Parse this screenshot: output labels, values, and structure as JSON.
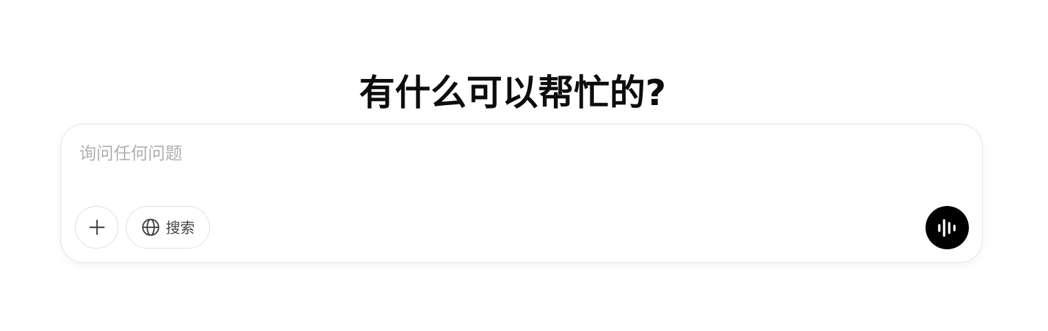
{
  "headline": "有什么可以帮忙的?",
  "composer": {
    "placeholder": "询问任何问题",
    "value": ""
  },
  "toolbar": {
    "attach_icon": "plus-icon",
    "search_icon": "globe-icon",
    "search_label": "搜索",
    "voice_icon": "voice-waveform-icon"
  },
  "colors": {
    "voice_button_bg": "#000000",
    "placeholder": "#b0b0b0",
    "border": "#e3e3e3"
  }
}
